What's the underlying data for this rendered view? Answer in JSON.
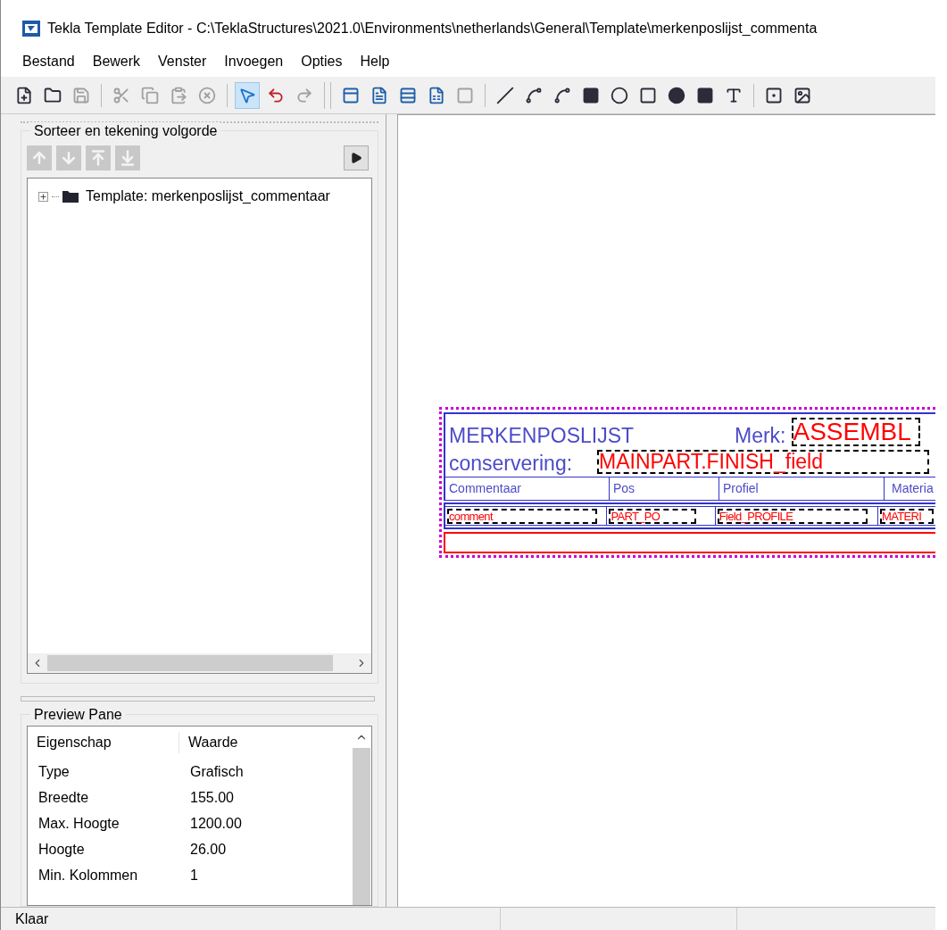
{
  "window": {
    "title": "Tekla Template Editor - C:\\TeklaStructures\\2021.0\\Environments\\netherlands\\General\\Template\\merkenposlijst_commenta"
  },
  "menu": [
    "Bestand",
    "Bewerk",
    "Venster",
    "Invoegen",
    "Opties",
    "Help"
  ],
  "toolbar": [
    [
      {
        "selected": false,
        "disabled": false
      },
      {
        "selected": false,
        "disabled": false
      },
      {
        "selected": false,
        "disabled": true
      }
    ],
    [
      {
        "selected": false,
        "disabled": true
      },
      {
        "selected": false,
        "disabled": true
      },
      {
        "selected": false,
        "disabled": true
      },
      {
        "selected": false,
        "disabled": true
      }
    ],
    [
      {
        "selected": true,
        "disabled": false
      },
      {
        "selected": false,
        "disabled": false
      },
      {
        "selected": false,
        "disabled": true
      }
    ],
    [
      {
        "selected": false,
        "disabled": false
      },
      {
        "selected": false,
        "disabled": false
      },
      {
        "selected": false,
        "disabled": false
      },
      {
        "selected": false,
        "disabled": false
      },
      {
        "selected": false,
        "disabled": true
      }
    ],
    [
      {
        "selected": false,
        "disabled": false
      },
      {
        "selected": false,
        "disabled": false
      },
      {
        "selected": false,
        "disabled": false
      },
      {
        "selected": false,
        "disabled": false
      },
      {
        "selected": false,
        "disabled": false
      },
      {
        "selected": false,
        "disabled": false
      },
      {
        "selected": false,
        "disabled": false
      },
      {
        "selected": false,
        "disabled": false
      },
      {
        "selected": false,
        "disabled": false
      }
    ],
    [
      {
        "selected": false,
        "disabled": false
      },
      {
        "selected": false,
        "disabled": false
      }
    ]
  ],
  "sort_panel": {
    "title": "Sorteer en tekening volgorde",
    "order_buttons": [
      {
        "disabled": true
      },
      {
        "disabled": true
      },
      {
        "disabled": true
      },
      {
        "disabled": true
      }
    ],
    "tree": [
      {
        "label": "Template: merkenposlijst_commentaar",
        "expanded": false
      }
    ]
  },
  "preview_pane": {
    "title": "Preview Pane",
    "columns": [
      "Eigenschap",
      "Waarde"
    ],
    "rows": [
      [
        "Type",
        "Grafisch"
      ],
      [
        "Breedte",
        "155.00"
      ],
      [
        "Max. Hoogte",
        "1200.00"
      ],
      [
        "Hoogte",
        "26.00"
      ],
      [
        "Min. Kolommen",
        "1"
      ]
    ]
  },
  "template": {
    "title": "MERKENPOSLIJST",
    "merk_label": "Merk:",
    "merk_field": "ASSEMBL",
    "conservering_label": "conservering:",
    "conservering_field": "MAINPART.FINISH_field",
    "columns": [
      "Commentaar",
      "Pos",
      "Profiel",
      "Materia"
    ],
    "fields": [
      "comment",
      "PART_PO",
      "Field_PROFILE",
      "MATERI"
    ]
  },
  "status_bar": {
    "text": "Klaar"
  }
}
